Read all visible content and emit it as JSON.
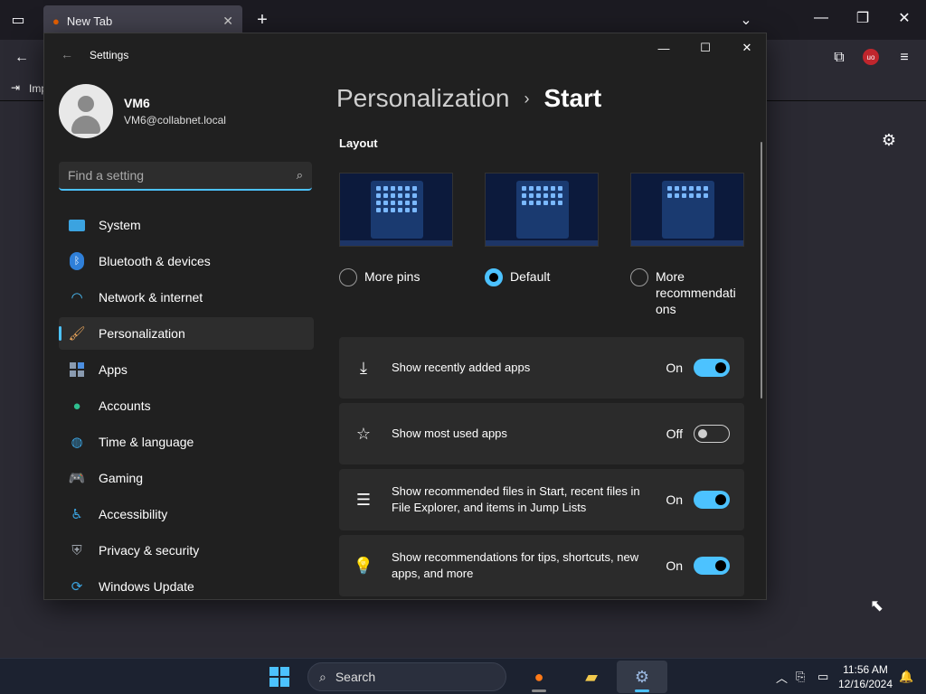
{
  "browser": {
    "tab_title": "New Tab",
    "tab_close": "✕",
    "new_tab": "+",
    "bookmark_label": "Imp"
  },
  "settings": {
    "window_title": "Settings",
    "profile": {
      "name": "VM6",
      "email": "VM6@collabnet.local"
    },
    "search": {
      "placeholder": "Find a setting"
    },
    "nav": [
      {
        "label": "System",
        "icon": "monitor-icon"
      },
      {
        "label": "Bluetooth & devices",
        "icon": "bluetooth-icon"
      },
      {
        "label": "Network & internet",
        "icon": "wifi-icon"
      },
      {
        "label": "Personalization",
        "icon": "brush-icon",
        "active": true
      },
      {
        "label": "Apps",
        "icon": "apps-icon"
      },
      {
        "label": "Accounts",
        "icon": "person-icon"
      },
      {
        "label": "Time & language",
        "icon": "globe-clock-icon"
      },
      {
        "label": "Gaming",
        "icon": "controller-icon"
      },
      {
        "label": "Accessibility",
        "icon": "accessibility-icon"
      },
      {
        "label": "Privacy & security",
        "icon": "shield-icon"
      },
      {
        "label": "Windows Update",
        "icon": "update-icon"
      }
    ],
    "breadcrumb": {
      "parent": "Personalization",
      "separator": "›",
      "current": "Start"
    },
    "layout_title": "Layout",
    "layout_options": [
      {
        "label": "More pins",
        "selected": false
      },
      {
        "label": "Default",
        "selected": true
      },
      {
        "label": "More recommendati ons",
        "selected": false
      }
    ],
    "toggles": [
      {
        "label": "Show recently added apps",
        "state": "On",
        "icon": "download-icon"
      },
      {
        "label": "Show most used apps",
        "state": "Off",
        "icon": "star-icon"
      },
      {
        "label": "Show recommended files in Start, recent files in File Explorer, and items in Jump Lists",
        "state": "On",
        "icon": "list-icon"
      },
      {
        "label": "Show recommendations for tips, shortcuts, new apps, and more",
        "state": "On",
        "icon": "lightbulb-icon"
      }
    ]
  },
  "taskbar": {
    "search_label": "Search",
    "time": "11:56 AM",
    "date": "12/16/2024"
  },
  "colors": {
    "accent": "#4cc2ff",
    "window_bg": "#202020",
    "card_bg": "#2b2b2b"
  }
}
